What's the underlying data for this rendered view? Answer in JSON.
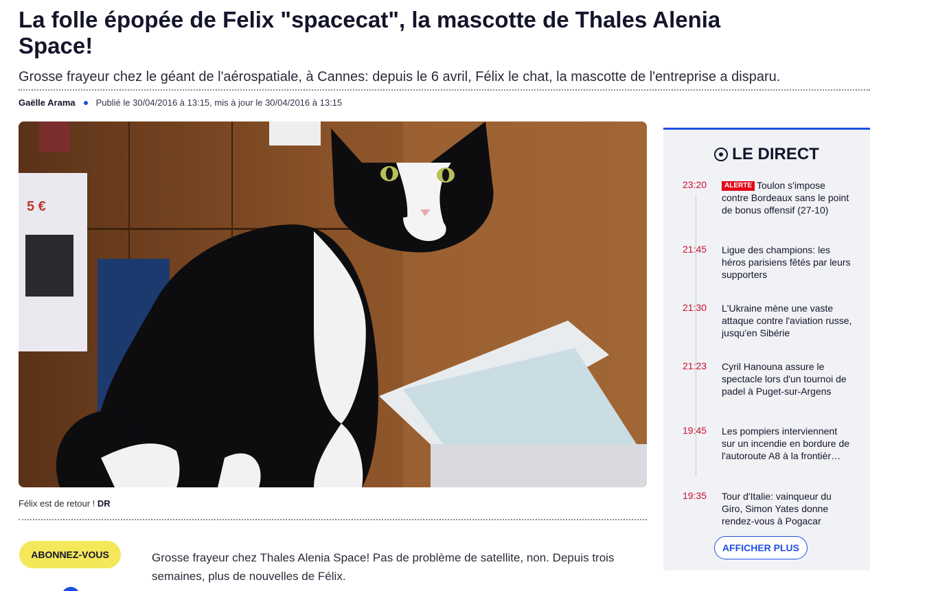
{
  "article": {
    "headline": "La folle épopée de Felix \"spacecat\", la mascotte de Thales Alenia Space!",
    "lede": "Grosse frayeur chez le géant de l'aérospatiale, à Cannes: depuis le 6 avril, Félix le chat, la mascotte de l'entreprise a disparu.",
    "author": "Gaëlle Arama",
    "dates": "Publié le 30/04/2016 à 13:15, mis à jour le 30/04/2016 à 13:15",
    "caption": "Félix est de retour !",
    "caption_credit": "DR",
    "body": "Grosse frayeur chez Thales Alenia Space! Pas de problème de satellite, non. Depuis trois semaines, plus de nouvelles de Félix."
  },
  "subscribe_label": "ABONNEZ-VOUS",
  "live": {
    "title": "LE DIRECT",
    "items": [
      {
        "time": "23:20",
        "badge": "ALERTE",
        "text": "Toulon s'impose contre Bordeaux sans le point de bonus offensif (27-10)"
      },
      {
        "time": "21:45",
        "text": "Ligue des champions: les héros parisiens fêtés par leurs supporters"
      },
      {
        "time": "21:30",
        "text": "L'Ukraine mène une vaste attaque contre l'aviation russe, jusqu'en Sibérie"
      },
      {
        "time": "21:23",
        "text": "Cyril Hanouna assure le spectacle lors d'un tournoi de padel à Puget-sur-Argens"
      },
      {
        "time": "19:45",
        "text": "Les pompiers interviennent sur un incendie en bordure de l'autoroute A8 à la frontièr…"
      },
      {
        "time": "19:35",
        "text": "Tour d'Italie: vainqueur du Giro, Simon Yates donne rendez-vous à Pogacar"
      }
    ],
    "more_label": "AFFICHER PLUS"
  },
  "colors": {
    "accent": "#1f4fe0",
    "alert": "#e3051b",
    "time": "#c8102e",
    "subscribe": "#f4e85a"
  }
}
